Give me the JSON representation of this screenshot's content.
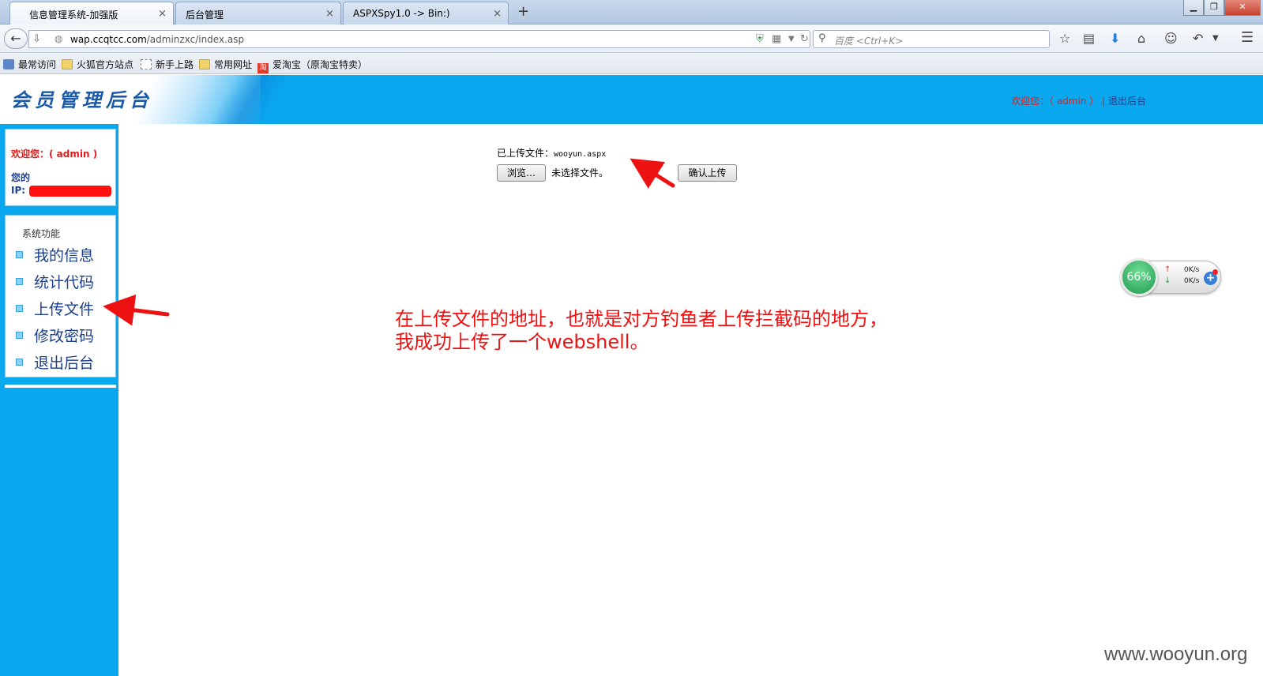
{
  "browser": {
    "tabs": [
      {
        "label": "信息管理系统-加强版"
      },
      {
        "label": "后台管理"
      },
      {
        "label": "ASPXSpy1.0 -> Bin:)"
      }
    ],
    "tab_close": "×",
    "new_tab": "+",
    "url_host": "wap.ccqtcc.com",
    "url_path": "/adminzxc/index.asp",
    "search_placeholder": "百度 <Ctrl+K>",
    "bookmarks": [
      {
        "label": "最常访问",
        "icon": "star"
      },
      {
        "label": "火狐官方站点",
        "icon": "folder"
      },
      {
        "label": "新手上路",
        "icon": "page"
      },
      {
        "label": "常用网址",
        "icon": "folder"
      },
      {
        "label": "爱淘宝（原淘宝特卖）",
        "icon": "taobao"
      }
    ]
  },
  "header": {
    "title": "会员管理后台",
    "welcome": "欢迎您：（ admin ）",
    "separator": "|",
    "logout": "退出后台"
  },
  "sidebar": {
    "welcome": "欢迎您：( admin )",
    "ip_label_1": "您的",
    "ip_label_2": "IP:",
    "section_title": "系统功能",
    "items": [
      {
        "label": "我的信息"
      },
      {
        "label": "统计代码"
      },
      {
        "label": "上传文件"
      },
      {
        "label": "修改密码"
      },
      {
        "label": "退出后台"
      }
    ]
  },
  "main": {
    "uploaded_label": "已上传文件：",
    "uploaded_file": "wooyun.aspx",
    "browse_button": "浏览…",
    "no_file_text": "未选择文件。",
    "submit_button": "确认上传",
    "annotation_line1": "在上传文件的地址，也就是对方钓鱼者上传拦截码的地方，",
    "annotation_line2": "我成功上传了一个webshell。"
  },
  "net_widget": {
    "percent": "66%",
    "up_speed": "0K/s",
    "down_speed": "0K/s",
    "up_arrow": "↑",
    "down_arrow": "↓",
    "plus": "+"
  },
  "watermark": "www.wooyun.org",
  "colors": {
    "brand_blue": "#0aa8ef",
    "nav_text": "#1d3f8a",
    "alert_red": "#ee1111"
  }
}
